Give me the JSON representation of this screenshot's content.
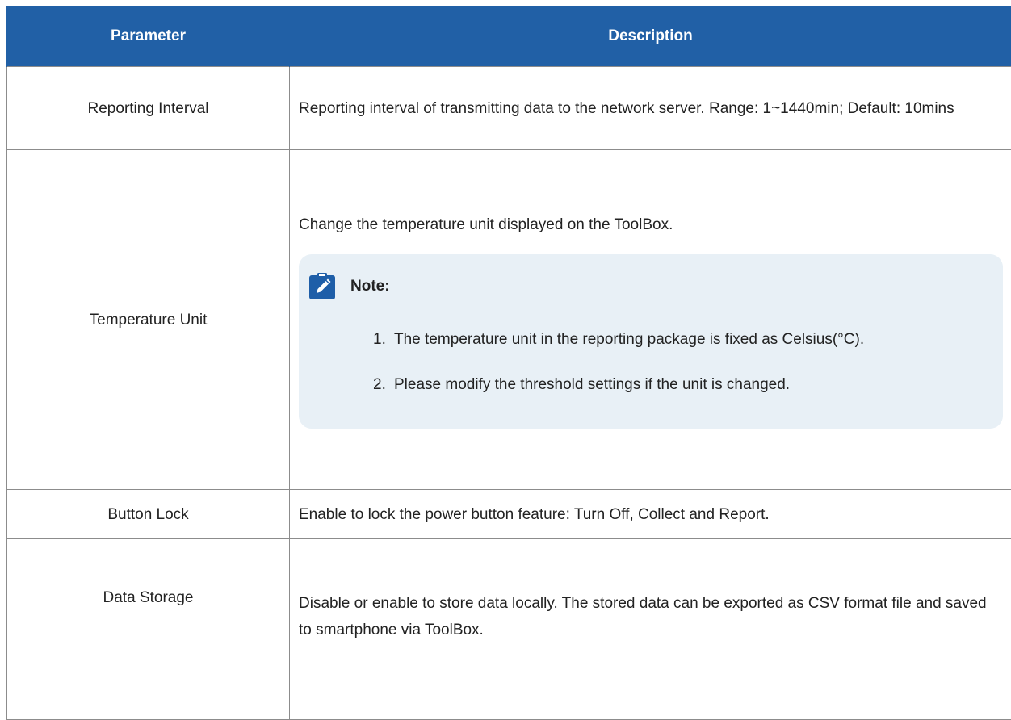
{
  "table": {
    "headers": {
      "parameter": "Parameter",
      "description": "Description"
    },
    "rows": [
      {
        "parameter": "Reporting Interval",
        "description": "Reporting interval of transmitting data to the network server. Range: 1~1440min; Default: 10mins"
      },
      {
        "parameter": "Temperature Unit",
        "description": "Change the temperature unit displayed on the ToolBox.",
        "note": {
          "title": "Note:",
          "items": [
            {
              "number": "1.",
              "text": "The temperature unit in the reporting package is fixed as Celsius(°C)."
            },
            {
              "number": "2.",
              "text": "Please modify the threshold settings if the unit is changed."
            }
          ]
        }
      },
      {
        "parameter": "Button Lock",
        "description": "Enable to lock the power button feature: Turn Off, Collect and Report."
      },
      {
        "parameter": "Data Storage",
        "description": "Disable or enable to store data locally. The stored data can be exported as CSV format file and saved to smartphone via ToolBox."
      }
    ]
  },
  "colors": {
    "header_bg": "#2160a6",
    "note_bg": "#e8f0f6",
    "icon_accent": "#1e5ea8"
  },
  "icons": {
    "note_icon": "pencil-clipboard-icon"
  }
}
